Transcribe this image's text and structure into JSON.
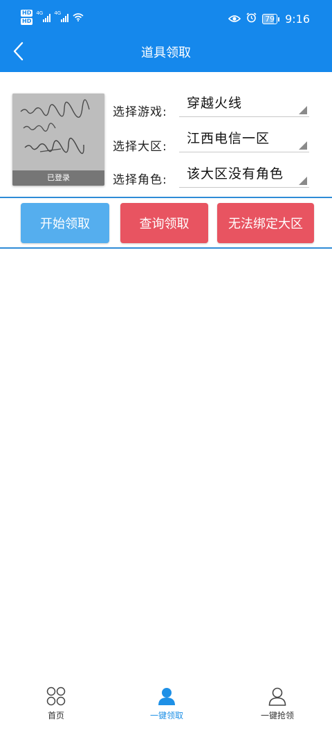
{
  "status_bar": {
    "hd_badges": [
      "HD",
      "HD"
    ],
    "signal_labels": [
      "4G",
      "4G"
    ],
    "battery": "79",
    "battery_level": 0.79,
    "time": "9:16",
    "icons": [
      "hd-icon",
      "signal-icon",
      "wifi-icon",
      "eye-icon",
      "alarm-icon",
      "battery-icon"
    ]
  },
  "header": {
    "title": "道具领取",
    "back_icon": "chevron-left-icon"
  },
  "profile": {
    "status_badge": "已登录"
  },
  "selectors": [
    {
      "label": "选择游戏:",
      "value": "穿越火线"
    },
    {
      "label": "选择大区:",
      "value": "江西电信一区"
    },
    {
      "label": "选择角色:",
      "value": "该大区没有角色"
    }
  ],
  "actions": {
    "start": "开始领取",
    "query": "查询领取",
    "cannot_bind": "无法绑定大区"
  },
  "bottom_nav": [
    {
      "label": "首页",
      "icon": "grid-circles-icon",
      "active": false
    },
    {
      "label": "一键领取",
      "icon": "person-icon",
      "active": true
    },
    {
      "label": "一键抢领",
      "icon": "person-outline-icon",
      "active": false
    }
  ],
  "colors": {
    "primary": "#1588ec",
    "start_button": "#55aeee",
    "danger_button": "#e85461",
    "active_nav": "#1e90e6"
  }
}
